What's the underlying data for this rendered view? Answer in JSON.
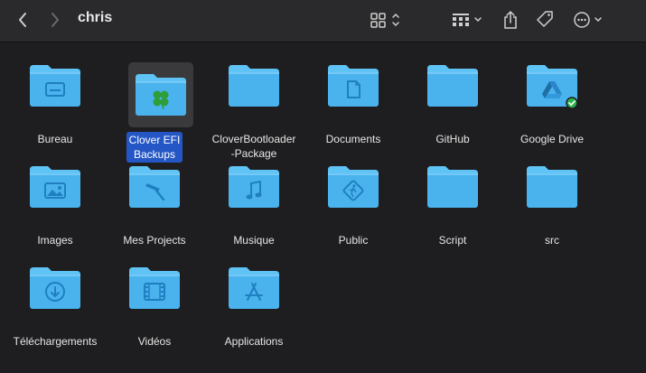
{
  "window": {
    "title": "chris"
  },
  "toolbar": {
    "back": "back",
    "forward": "forward",
    "view_mode": "icon-view",
    "group_by": "group",
    "share": "share",
    "tags": "tags",
    "more": "more"
  },
  "folders": [
    {
      "label": "Bureau",
      "glyph": "desktop-icon"
    },
    {
      "label": "Clover EFI Backups",
      "line1": "Clover EFI",
      "line2": "Backups",
      "glyph": "clover-icon",
      "selected": true
    },
    {
      "label": "CloverBootloader-Package",
      "line1": "CloverBootloader",
      "line2": "-Package",
      "glyph": ""
    },
    {
      "label": "Documents",
      "glyph": "document-icon"
    },
    {
      "label": "GitHub",
      "glyph": ""
    },
    {
      "label": "Google Drive",
      "glyph": "google-drive-icon",
      "badge": "synced-check"
    },
    {
      "label": "Images",
      "glyph": "photo-icon"
    },
    {
      "label": "Mes Projects",
      "glyph": "hammer-icon"
    },
    {
      "label": "Musique",
      "glyph": "music-note-icon"
    },
    {
      "label": "Public",
      "glyph": "public-icon"
    },
    {
      "label": "Script",
      "glyph": ""
    },
    {
      "label": "src",
      "glyph": ""
    },
    {
      "label": "Téléchargements",
      "glyph": "download-icon"
    },
    {
      "label": "Vidéos",
      "glyph": "film-icon"
    },
    {
      "label": "Applications",
      "glyph": "app-store-icon"
    }
  ],
  "colors": {
    "folder": "#4ab3ee",
    "folder_tab": "#5fc3f5",
    "selection": "#2457c5",
    "badge": "#2bb24c"
  }
}
